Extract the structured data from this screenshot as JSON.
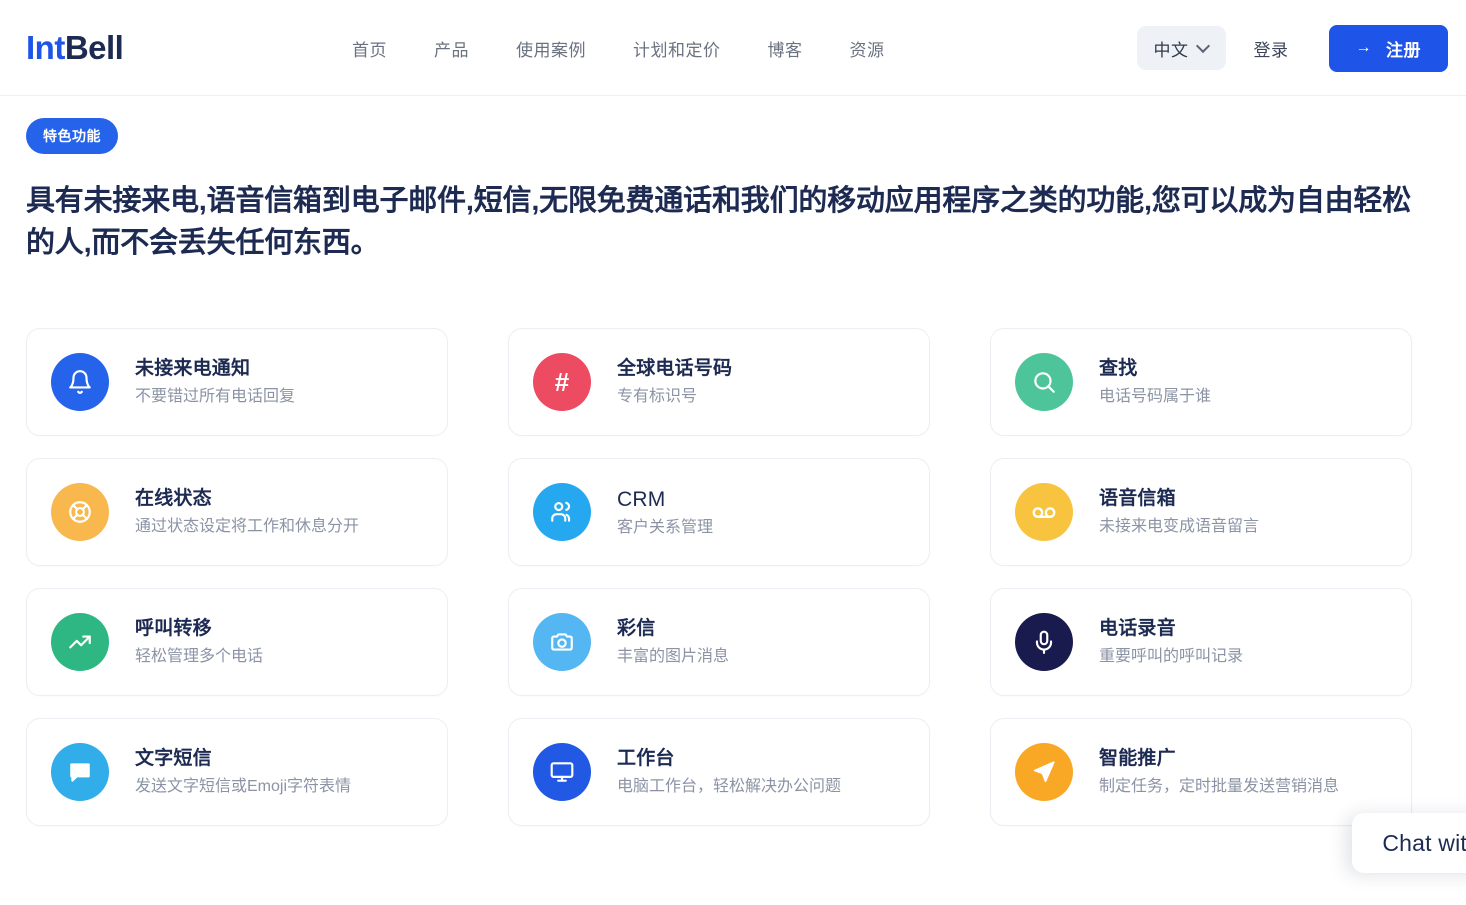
{
  "header": {
    "logo": {
      "part1": "Int",
      "part2": "Bell",
      "color1": "#1e55e8",
      "color2": "#1d2a52"
    },
    "nav": [
      {
        "label": "首页"
      },
      {
        "label": "产品"
      },
      {
        "label": "使用案例"
      },
      {
        "label": "计划和定价"
      },
      {
        "label": "博客"
      },
      {
        "label": "资源"
      }
    ],
    "language": {
      "label": "中文",
      "icon": "chevron-down-icon"
    },
    "login_label": "登录",
    "signup": {
      "label": "注册",
      "arrow": "→",
      "color": "#1e55e8"
    }
  },
  "hero": {
    "badge": "特色功能",
    "headline": "具有未接来电,语音信箱到电子邮件,短信,无限免费通话和我们的移动应用程序之类的功能,您可以成为自由轻松的人,而不会丢失任何东西。"
  },
  "features": [
    {
      "title": "未接来电通知",
      "subtitle": "不要错过所有电话回复",
      "icon": "bell-icon",
      "color": "#2563eb",
      "title_weight": "bold"
    },
    {
      "title": "全球电话号码",
      "subtitle": "专有标识号",
      "icon": "hash-icon",
      "color": "#ec4b61",
      "title_weight": "bold"
    },
    {
      "title": "查找",
      "subtitle": "电话号码属于谁",
      "icon": "search-icon",
      "color": "#4ec49b",
      "title_weight": "bold"
    },
    {
      "title": "在线状态",
      "subtitle": "通过状态设定将工作和休息分开",
      "icon": "status-lifebuoy-icon",
      "color": "#f8b84e",
      "title_weight": "bold"
    },
    {
      "title": "CRM",
      "subtitle": "客户关系管理",
      "icon": "users-icon",
      "color": "#25a8f0",
      "title_weight": "regular"
    },
    {
      "title": "语音信箱",
      "subtitle": "未接来电变成语音留言",
      "icon": "voicemail-icon",
      "color": "#f8c33f",
      "title_weight": "bold"
    },
    {
      "title": "呼叫转移",
      "subtitle": "轻松管理多个电话",
      "icon": "trending-up-icon",
      "color": "#2eb783",
      "title_weight": "bold"
    },
    {
      "title": "彩信",
      "subtitle": "丰富的图片消息",
      "icon": "camera-icon",
      "color": "#54b6f2",
      "title_weight": "bold"
    },
    {
      "title": "电话录音",
      "subtitle": "重要呼叫的呼叫记录",
      "icon": "microphone-icon",
      "color": "#191a4d",
      "title_weight": "bold"
    },
    {
      "title": "文字短信",
      "subtitle": "发送文字短信或Emoji字符表情",
      "icon": "message-bubble-icon",
      "color": "#31ade9",
      "title_weight": "bold"
    },
    {
      "title": "工作台",
      "subtitle": "电脑工作台，轻松解决办公问题",
      "icon": "monitor-icon",
      "color": "#2159e4",
      "title_weight": "bold"
    },
    {
      "title": "智能推广",
      "subtitle": "制定任务，定时批量发送营销消息",
      "icon": "send-icon",
      "color": "#f9a825",
      "title_weight": "bold"
    }
  ],
  "chat_widget": {
    "label": "Chat with"
  }
}
